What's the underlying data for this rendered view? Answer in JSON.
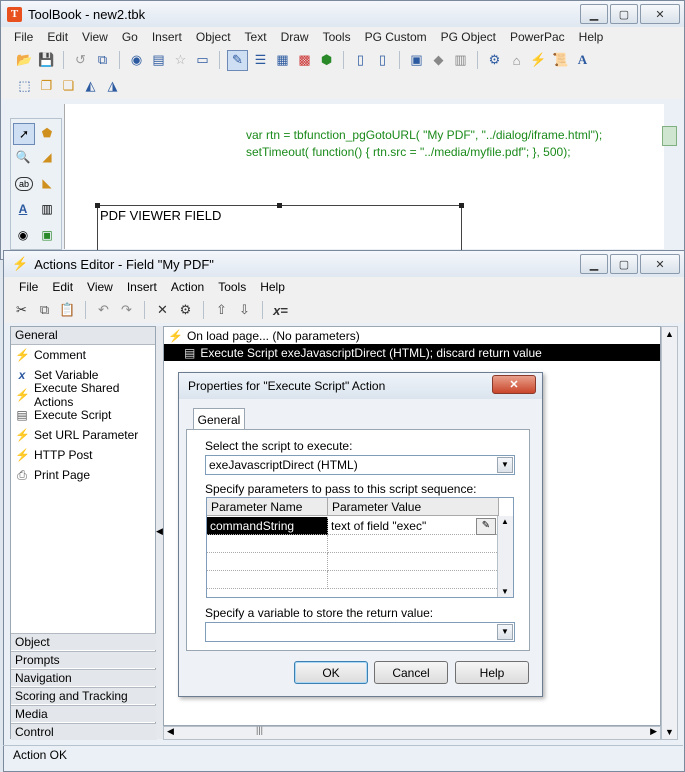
{
  "main_window": {
    "title": "ToolBook - new2.tbk",
    "menu": [
      "File",
      "Edit",
      "View",
      "Go",
      "Insert",
      "Object",
      "Text",
      "Draw",
      "Tools",
      "PG Custom",
      "PG Object",
      "PowerPac",
      "Help"
    ],
    "code_lines": [
      "var rtn = tbfunction_pgGotoURL( \"My PDF\", \"../dialog/iframe.html\");",
      "setTimeout( function() { rtn.src = \"../media/myfile.pdf\"; }, 500);"
    ],
    "field_label": "PDF VIEWER FIELD"
  },
  "actions_editor": {
    "title": "Actions Editor - Field \"My PDF\"",
    "menu": [
      "File",
      "Edit",
      "View",
      "Insert",
      "Action",
      "Tools",
      "Help"
    ],
    "left_panel": {
      "header": "General",
      "items": [
        {
          "label": "Comment",
          "icon": "lightning-icon"
        },
        {
          "label": "Set Variable",
          "icon": "variable-icon"
        },
        {
          "label": "Execute Shared Actions",
          "icon": "lightning-icon"
        },
        {
          "label": "Execute Script",
          "icon": "script-icon"
        },
        {
          "label": "Set URL Parameter",
          "icon": "lightning-icon"
        },
        {
          "label": "HTTP Post",
          "icon": "lightning-icon"
        },
        {
          "label": "Print Page",
          "icon": "printer-icon"
        }
      ],
      "categories": [
        "Object",
        "Prompts",
        "Navigation",
        "Scoring and Tracking",
        "Media",
        "Control"
      ]
    },
    "actions": [
      "On load page... (No parameters)",
      "Execute Script exeJavascriptDirect (HTML); discard return value"
    ],
    "status": "Action OK"
  },
  "dialog": {
    "title": "Properties for \"Execute Script\" Action",
    "tab": "General",
    "select_label": "Select the script to execute:",
    "script_value": "exeJavascriptDirect (HTML)",
    "params_label": "Specify parameters to pass to this script sequence:",
    "columns": [
      "Parameter Name",
      "Parameter Value"
    ],
    "rows": [
      {
        "name": "commandString",
        "value": "text of field \"exec\""
      }
    ],
    "return_label": "Specify a variable to store the return value:",
    "return_value": "",
    "buttons": {
      "ok": "OK",
      "cancel": "Cancel",
      "help": "Help"
    }
  }
}
